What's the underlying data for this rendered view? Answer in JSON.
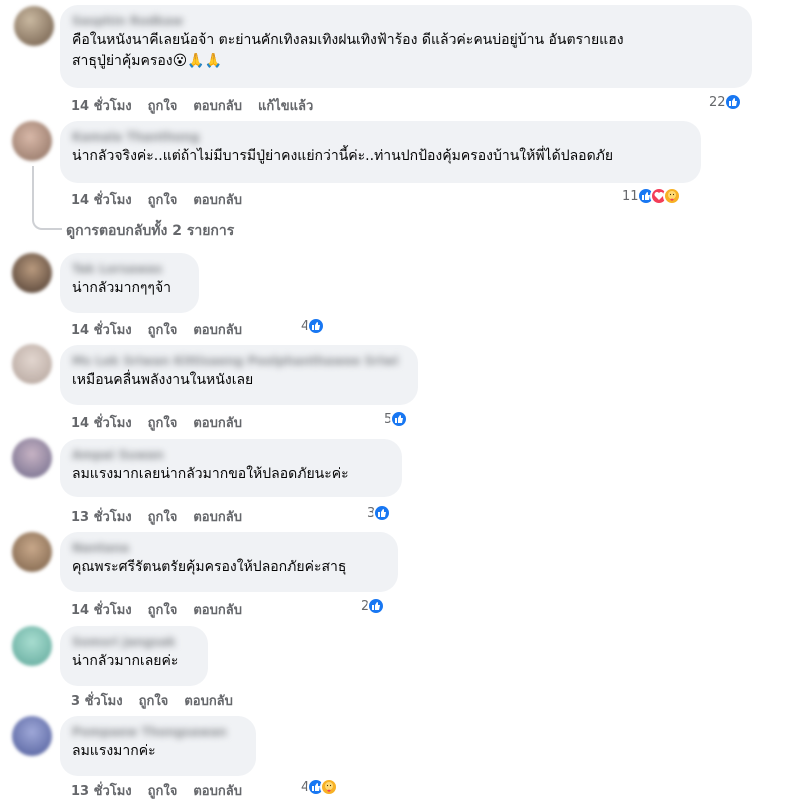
{
  "colors": {
    "bubble": "#f0f2f5",
    "meta": "#65676b",
    "like": "#1877f2",
    "love": "#f33e58",
    "care": "#f7b125"
  },
  "comments": [
    {
      "author": "Sasphin Rodkaw",
      "text": "คือในหนังนาคีเลยน้อจ้า ตะย่านคักเทิงลมเทิงฝนเทิงฟ้าร้อง ดีแล้วค่ะคนบ่อยู่บ้าน อันตรายแฮง\nสาธุปู่ย่าคุ้มครอง😮🙏🙏",
      "time": "14 ชั่วโมง",
      "like": "ถูกใจ",
      "reply": "ตอบกลับ",
      "edited": "แก้ไขแล้ว",
      "reaction_count": "22",
      "reactions": [
        "like-icon"
      ]
    },
    {
      "author": "Kamala Thanthong",
      "text": "น่ากลัวจริงค่ะ..แต่ถ้าไม่มีบารมีปู่ย่าคงแย่กว่านี้ค่ะ..ท่านปกป้องคุ้มครองบ้านให้พี่ได้ปลอดภัย",
      "time": "14 ชั่วโมง",
      "like": "ถูกใจ",
      "reply": "ตอบกลับ",
      "reaction_count": "11",
      "reactions": [
        "like-icon",
        "love-icon",
        "care-icon"
      ]
    },
    {
      "author": "Tak Lorsawas",
      "text": "น่ากลัวมากๆๆจ้า",
      "time": "14 ชั่วโมง",
      "like": "ถูกใจ",
      "reply": "ตอบกลับ",
      "reaction_count": "4",
      "reactions": [
        "like-icon"
      ]
    },
    {
      "author": "Ms Lek Sriwan Kittisaeng Poolphanthawee Sriwi",
      "text": "เหมือนคลื่นพลังงานในหนังเลย",
      "time": "14 ชั่วโมง",
      "like": "ถูกใจ",
      "reply": "ตอบกลับ",
      "reaction_count": "5",
      "reactions": [
        "like-icon"
      ]
    },
    {
      "author": "Ampai Suwan",
      "text": "ลมแรงมากเลยน่ากลัวมากขอให้ปลอดภัยนะค่ะ",
      "time": "13 ชั่วโมง",
      "like": "ถูกใจ",
      "reply": "ตอบกลับ",
      "reaction_count": "3",
      "reactions": [
        "like-icon"
      ]
    },
    {
      "author": "Nantana",
      "text": "คุณพระศรีรัตนตรัยคุ้มครองให้ปลอกภัยค่ะสาธุ",
      "time": "14 ชั่วโมง",
      "like": "ถูกใจ",
      "reply": "ตอบกลับ",
      "reaction_count": "2",
      "reactions": [
        "like-icon"
      ]
    },
    {
      "author": "Somsri Jangsak",
      "text": "น่ากลัวมากเลยค่ะ",
      "time": "3 ชั่วโมง",
      "like": "ถูกใจ",
      "reply": "ตอบกลับ"
    },
    {
      "author": "Pompaew Thongsawan",
      "text": "ลมแรงมากค่ะ",
      "time": "13 ชั่วโมง",
      "like": "ถูกใจ",
      "reply": "ตอบกลับ",
      "reaction_count": "4",
      "reactions": [
        "like-icon",
        "care-icon"
      ]
    }
  ],
  "view_replies": "ดูการตอบกลับทั้ง 2 รายการ"
}
